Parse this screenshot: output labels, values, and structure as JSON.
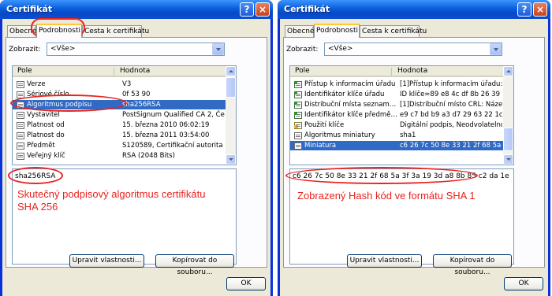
{
  "dialogs": [
    {
      "title": "Certifikát",
      "tabs": [
        "Obecné",
        "Podrobnosti",
        "Cesta k certifikátu"
      ],
      "show_label": "Zobrazit:",
      "show_value": "<Vše>",
      "columns": [
        "Pole",
        "Hodnota"
      ],
      "rows": [
        {
          "field": "Verze",
          "value": "V3"
        },
        {
          "field": "Sériové číslo",
          "value": "0f 53 90"
        },
        {
          "field": "Algoritmus podpisu",
          "value": "sha256RSA"
        },
        {
          "field": "Vystavitel",
          "value": "PostSignum Qualified CA 2, Če..."
        },
        {
          "field": "Platnost od",
          "value": "15. března 2010 06:02:19"
        },
        {
          "field": "Platnost do",
          "value": "15. března 2011 03:54:00"
        },
        {
          "field": "Předmět",
          "value": "S120589, Certifikační autorita ..."
        },
        {
          "field": "Veřejný klíč",
          "value": "RSA (2048 Bits)"
        }
      ],
      "detail_value": "sha256RSA",
      "annotation": "Skutečný podpisový algoritmus certifikátu SHA 256",
      "edit_button": "Upravit vlastnosti...",
      "copy_button": "Kopírovat do souboru...",
      "ok_button": "OK"
    },
    {
      "title": "Certifikát",
      "tabs": [
        "Obecné",
        "Podrobnosti",
        "Cesta k certifikátu"
      ],
      "show_label": "Zobrazit:",
      "show_value": "<Vše>",
      "columns": [
        "Pole",
        "Hodnota"
      ],
      "rows": [
        {
          "field": "Přístup k informacím úřadu",
          "value": "[1]Přístup k informacím úřadu: ..."
        },
        {
          "field": "Identifikátor klíče úřadu",
          "value": "ID klíče=89 e8 4c df 8b 26 39 ..."
        },
        {
          "field": "Distribuční místa seznamu o...",
          "value": "[1]Distribuční místo CRL: Náze..."
        },
        {
          "field": "Identifikátor klíče předmětu",
          "value": "e9 c7 bd b9 a3 d7 29 63 22 1c..."
        },
        {
          "field": "Použití klíče",
          "value": "Digitální podpis, Neodvolatelno..."
        },
        {
          "field": "Algoritmus miniatury",
          "value": "sha1"
        },
        {
          "field": "Miniatura",
          "value": "c6 26 7c 50 8e 33 21 2f 68 5a ..."
        }
      ],
      "detail_value": "c6 26 7c 50 8e 33 21 2f 68 5a 3f 3a 19 3d a8 8b 85 c2 da 1e",
      "annotation": "Zobrazený Hash kód ve formátu SHA 1",
      "edit_button": "Upravit vlastnosti...",
      "copy_button": "Kopírovat do souboru...",
      "ok_button": "OK"
    }
  ],
  "colors": {
    "annotation": "#e8231f",
    "selection": "#316ac5",
    "titlebar": "#0a5fd9"
  }
}
